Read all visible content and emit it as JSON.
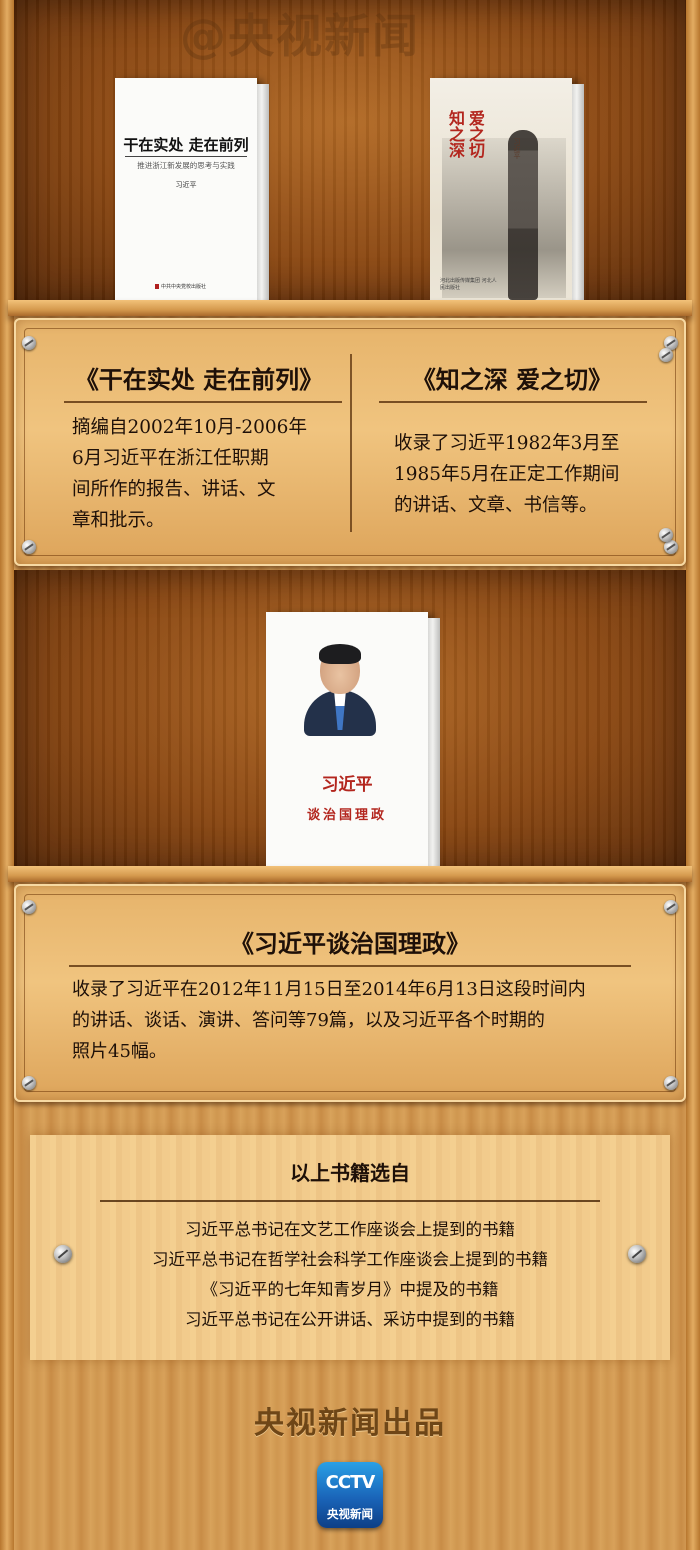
{
  "watermark": "@央视新闻",
  "shelf1": {
    "book_left": {
      "cover_title": "干在实处 走在前列",
      "cover_subtitle": "推进浙江新发展的思考与实践",
      "cover_author": "习近平",
      "publisher": "中共中央党校出版社"
    },
    "book_right": {
      "cover_title_line1": "知之深",
      "cover_title_line2": "爱之切",
      "cover_author": "习近平",
      "publisher": "河北出版传媒集团 河北人民出版社"
    }
  },
  "plaque1": {
    "left": {
      "title": "《干在实处 走在前列》",
      "lines": [
        "摘编自2002年10月-2006年",
        "6月习近平在浙江任职期",
        "间所作的报告、讲话、文",
        "章和批示。"
      ]
    },
    "right": {
      "title": "《知之深 爱之切》",
      "lines": [
        "收录了习近平1982年3月至",
        "1985年5月在正定工作期间",
        "的讲话、文章、书信等。"
      ]
    }
  },
  "shelf2": {
    "book": {
      "cover_author": "习近平",
      "cover_title": "谈治国理政"
    }
  },
  "plaque2": {
    "title": "《习近平谈治国理政》",
    "lines": [
      "收录了习近平在2012年11月15日至2014年6月13日这段时间内",
      "的讲话、谈话、演讲、答问等79篇，以及习近平各个时期的",
      "照片45幅。"
    ]
  },
  "sources": {
    "title": "以上书籍选自",
    "items": [
      "习近平总书记在文艺工作座谈会上提到的书籍",
      "习近平总书记在哲学社会科学工作座谈会上提到的书籍",
      "《习近平的七年知青岁月》中提及的书籍",
      "习近平总书记在公开讲话、采访中提到的书籍"
    ]
  },
  "footer": {
    "producer": "央视新闻出品",
    "logo_mark": "CCTV",
    "logo_text": "央视新闻"
  }
}
